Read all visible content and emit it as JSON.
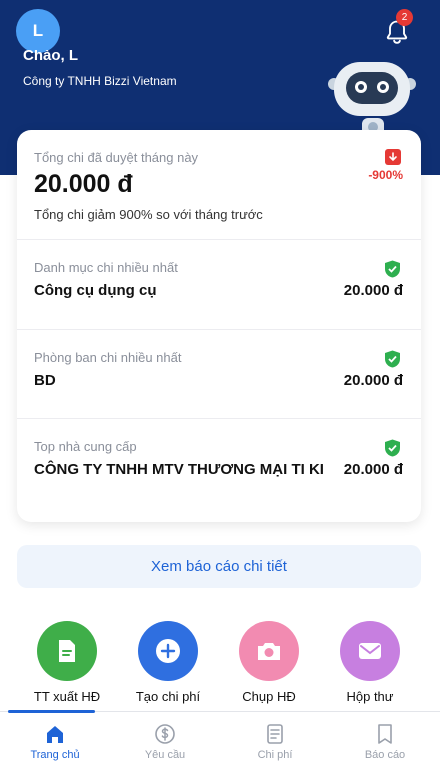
{
  "header": {
    "avatar_initial": "L",
    "notification_count": "2",
    "greeting": "Chào, L",
    "company": "Công ty TNHH Bizzi Vietnam"
  },
  "summary": {
    "total_label": "Tổng chi đã duyệt tháng này",
    "total_value": "20.000 đ",
    "change_percent": "-900%",
    "change_note": "Tổng chi giảm 900% so với tháng trước",
    "sections": [
      {
        "label": "Danh mục chi nhiều nhất",
        "title": "Công cụ dụng cụ",
        "amount": "20.000 đ"
      },
      {
        "label": "Phòng ban chi nhiều nhất",
        "title": "BD",
        "amount": "20.000 đ"
      },
      {
        "label": "Top nhà cung cấp",
        "title": "CÔNG TY TNHH MTV THƯƠNG MẠI TI KI",
        "amount": "20.000 đ"
      }
    ]
  },
  "detail_button_label": "Xem báo cáo chi tiết",
  "quick_actions": [
    {
      "label": "TT xuất HĐ",
      "icon": "invoice-document-icon",
      "color": "#3fae49"
    },
    {
      "label": "Tạo chi phí",
      "icon": "plus-circle-icon",
      "color": "#2f6fe0"
    },
    {
      "label": "Chụp HĐ",
      "icon": "camera-icon",
      "color": "#f28bb1"
    },
    {
      "label": "Hộp thư",
      "icon": "mail-icon",
      "color": "#c77fe0"
    }
  ],
  "tabs": [
    {
      "label": "Trang chủ",
      "icon": "home-icon",
      "active": true
    },
    {
      "label": "Yêu cầu",
      "icon": "money-request-icon",
      "active": false
    },
    {
      "label": "Chi phí",
      "icon": "expense-note-icon",
      "active": false
    },
    {
      "label": "Báo cáo",
      "icon": "report-book-icon",
      "active": false
    }
  ],
  "colors": {
    "header_bg": "#0f2f72",
    "accent": "#1e63d6",
    "negative": "#e53935",
    "verified": "#2eaf4f"
  }
}
